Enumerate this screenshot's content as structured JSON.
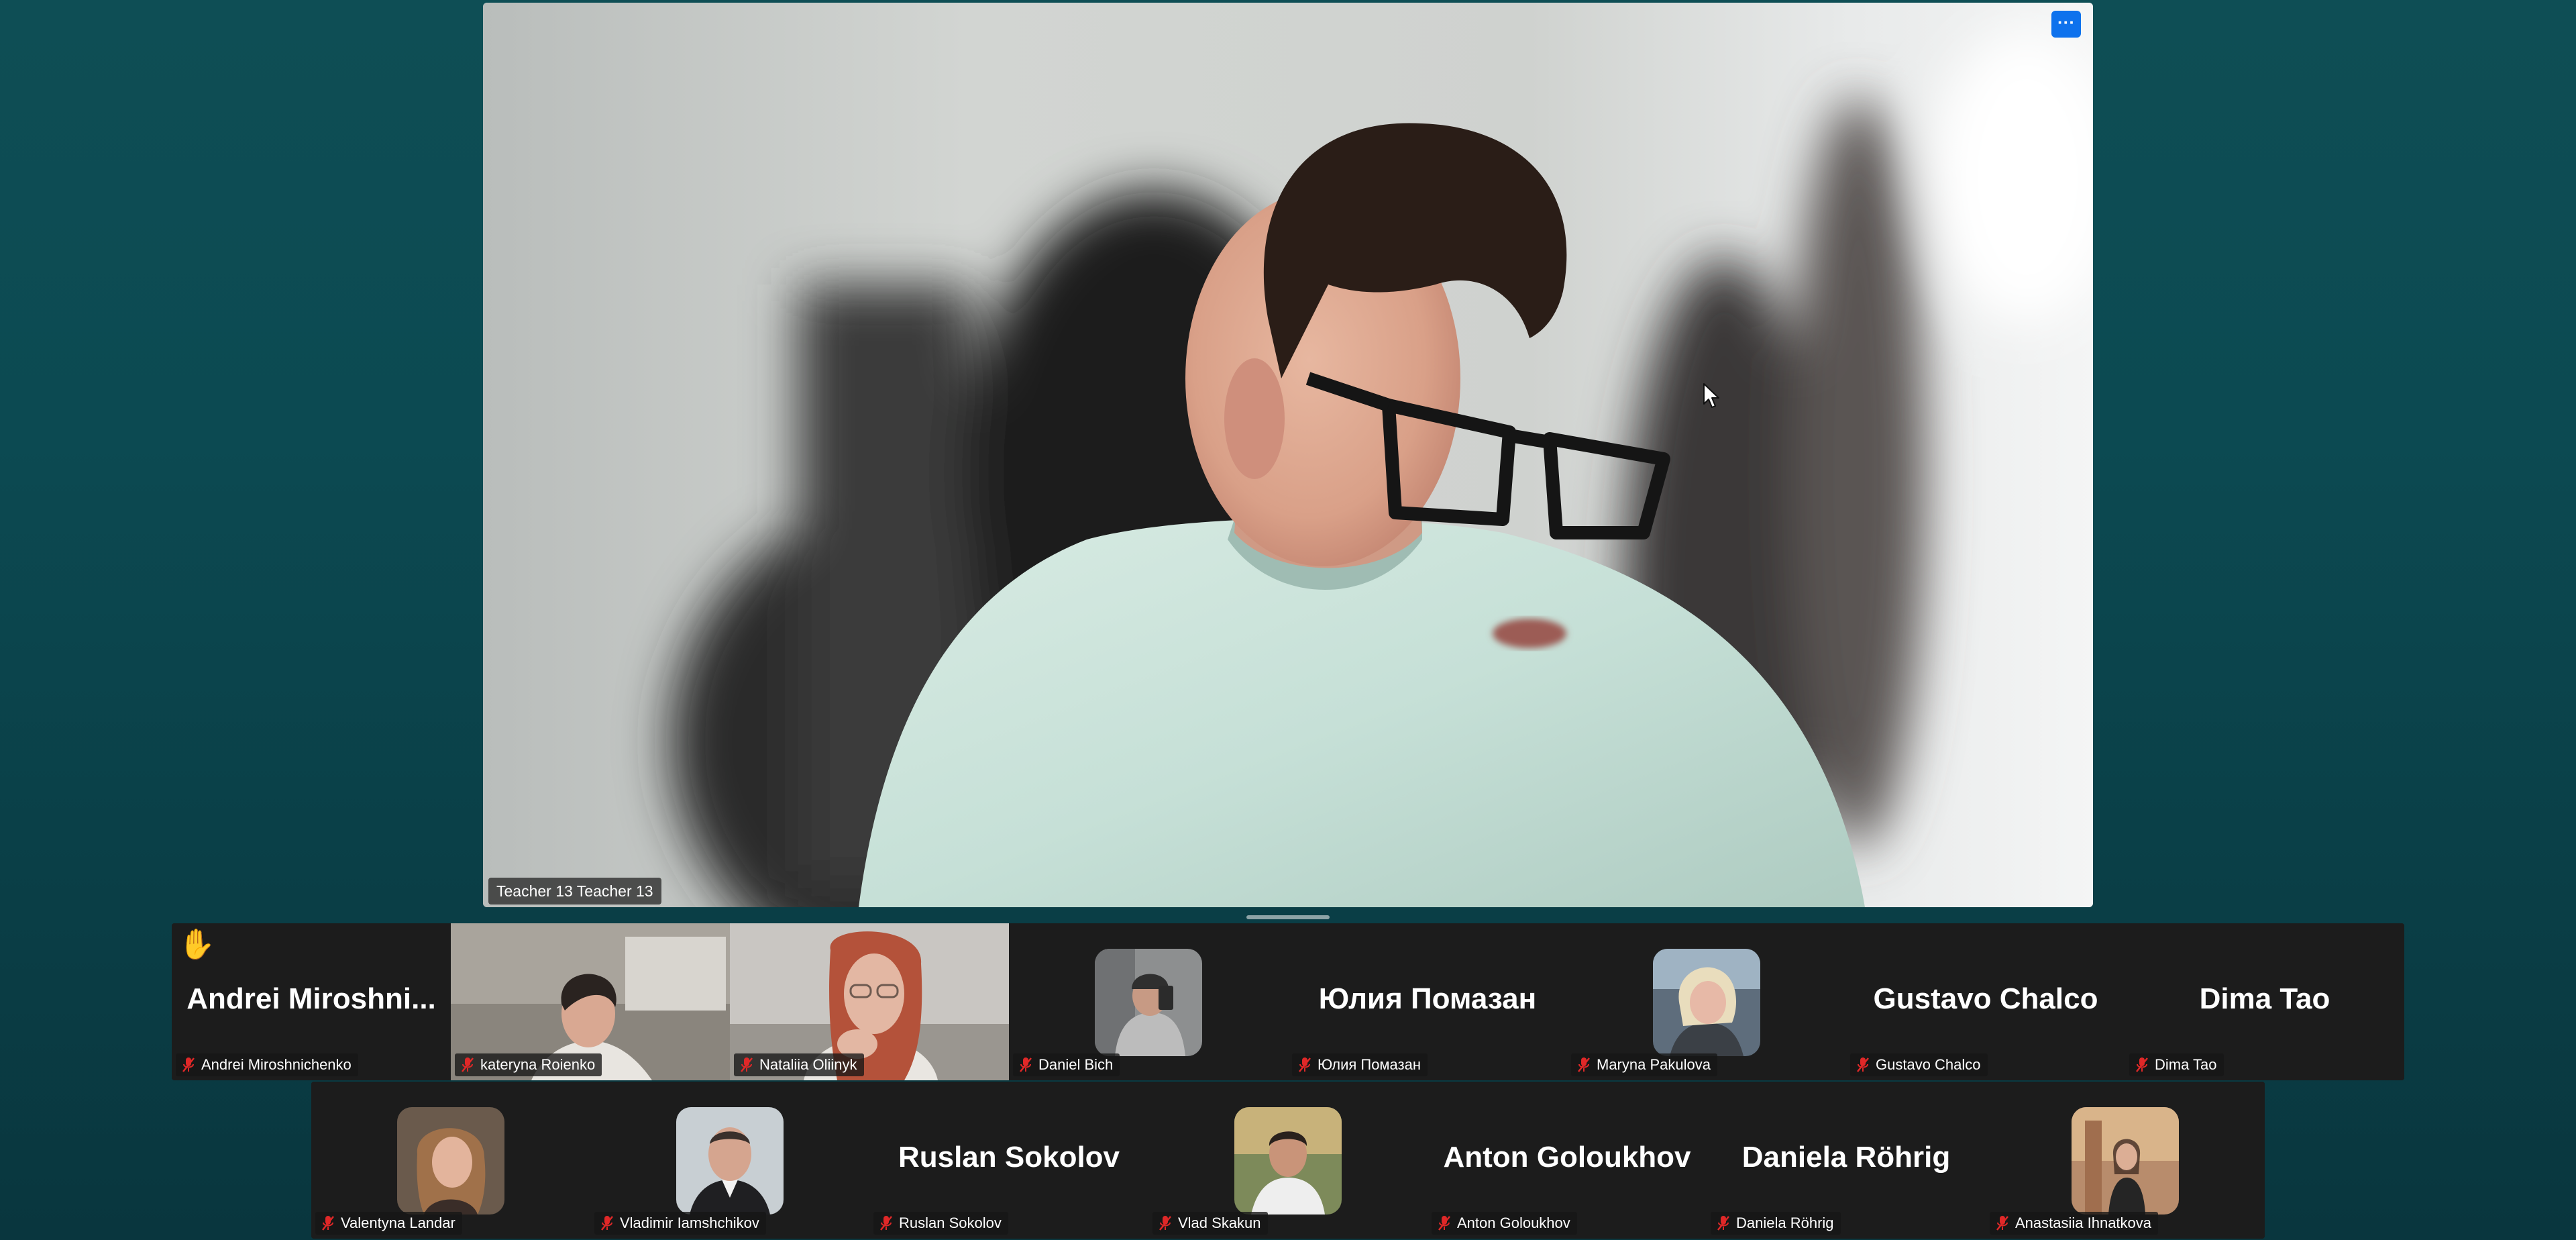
{
  "speaker": {
    "name": "Teacher 13 Teacher 13",
    "more_label": "···"
  },
  "icons": {
    "more": "more-options-icon",
    "muted": "mic-muted-icon",
    "raised_hand": "raised-hand-icon",
    "cursor": "mouse-cursor-icon"
  },
  "colors": {
    "accent": "#0e72ed",
    "tile_bg": "#1c1c1c",
    "mic_muted": "#e02828"
  },
  "gallery": {
    "row1": [
      {
        "display": "Andrei  Miroshni...",
        "label": "Andrei Miroshnichenko",
        "raised_hand": "✋"
      },
      {
        "label": "kateryna Roienko"
      },
      {
        "label": "Nataliia Oliinyk"
      },
      {
        "label": "Daniel Bich"
      },
      {
        "display": "Юлия Помазан",
        "label": "Юлия Помазан"
      },
      {
        "label": "Maryna Pakulova"
      },
      {
        "display": "Gustavo Chalco",
        "label": "Gustavo Chalco"
      },
      {
        "display": "Dima Tao",
        "label": "Dima Tao"
      }
    ],
    "row2": [
      {
        "label": "Valentyna Landar"
      },
      {
        "label": "Vladimir Iamshchikov"
      },
      {
        "display": "Ruslan Sokolov",
        "label": "Ruslan Sokolov"
      },
      {
        "label": "Vlad Skakun"
      },
      {
        "display": "Anton Goloukhov",
        "label": "Anton Goloukhov"
      },
      {
        "display": "Daniela Röhrig",
        "label": "Daniela Röhrig"
      },
      {
        "label": "Anastasiia Ihnatkova"
      }
    ]
  }
}
